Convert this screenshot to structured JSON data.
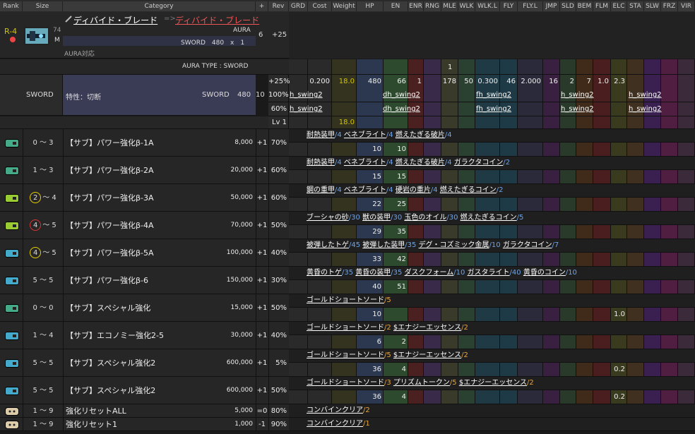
{
  "colors": {
    "HP": "#2b3850",
    "EN": "#2e4a2e",
    "ENR": "#4a2020",
    "RNG": "#3a2a4a",
    "MLE": "#3a3a2a",
    "WLK": "#2a4030",
    "WLKL": "#1f3a45",
    "FLY": "#1e3a46",
    "FLYL": "#2a2a3a",
    "JMP": "#3a2040",
    "SLD": "#2a3a2a",
    "BEM": "#402a1a",
    "FLM": "#4a1e1e",
    "ELC": "#3a3a1e",
    "STA": "#403020",
    "SLW": "#3a2050",
    "FRZ": "#501e40",
    "VIR": "#3a2a3a",
    "gold": "#d4c300",
    "accent": "#e44",
    "yellow_circle": "#e8d000",
    "red_circle": "#d33"
  },
  "header_labels": [
    "Rank",
    "Size",
    "Category",
    "+",
    "Rev",
    "GRD",
    "Cost",
    "Weight",
    "HP",
    "EN",
    "ENR",
    "RNG",
    "MLE",
    "WLK",
    "WLK.L",
    "FLY",
    "FLY.L",
    "JMP",
    "SLD",
    "BEM",
    "FLM",
    "ELC",
    "STA",
    "SLW",
    "FRZ",
    "VIR"
  ],
  "top": {
    "rank": "R-4",
    "size_num": "74",
    "size_letter": "M",
    "item_name": "ディバイド・ブレード",
    "arrow": "=>",
    "item_name_to": "ディバイド・ブレード",
    "aura": "AURA",
    "sword_line": "SWORD　480　x　1",
    "aura_support": "AURA対応",
    "plus": "6",
    "rev": "+25",
    "stat_mle": "1"
  },
  "aura_type": "AURA TYPE : SWORD",
  "sword_block": {
    "label": "SWORD",
    "trait": "特性：切断",
    "sword": "SWORD",
    "value": "480",
    "num": "10",
    "row1": {
      "rev": "+25%",
      "cost": "0.200",
      "weight": "18.0",
      "hp": "480",
      "en": "66",
      "enr": "1",
      "mle": "178",
      "wlk": "50",
      "wlkl": "0.300",
      "fly": "46",
      "flyl": "2.000",
      "jmp": "16",
      "sld": "2",
      "bem": "7",
      "flm": "1.0",
      "elc": "2.3"
    },
    "row2": {
      "rev": "100%",
      "s1": "h_swing2",
      "s2": "dh_swing2",
      "s3": "fh_swing2",
      "s4": "h_swing2",
      "s5": "h_swing2"
    },
    "row3": {
      "rev": "60%",
      "s1": "h_swing2",
      "s2": "dh_swing2",
      "s3": "fh_swing2",
      "s4": "h_swing2",
      "s5": "h_swing2"
    },
    "lv": "Lv 1",
    "lv_weight": "18.0"
  },
  "rows": [
    {
      "icon": "chip-icon",
      "rank": "0 ～ 3",
      "name": "【サブ】パワー強化β-1A",
      "cost": "8,000",
      "plus": "+1",
      "rev": "70%",
      "mats": [
        {
          "n": "耐熱装甲",
          "c": "/4"
        },
        {
          "n": "ベネブライト",
          "c": "/4"
        },
        {
          "n": "燃えたぎる破片",
          "c": "/4"
        }
      ],
      "hp": "10",
      "en": "10",
      "elc": ""
    },
    {
      "icon": "chip-icon",
      "rank": "1 ～ 3",
      "name": "【サブ】パワー強化β-2A",
      "cost": "20,000",
      "plus": "+1",
      "rev": "60%",
      "mats": [
        {
          "n": "耐熱装甲",
          "c": "/4"
        },
        {
          "n": "ベネブライト",
          "c": "/4"
        },
        {
          "n": "燃えたぎる破片",
          "c": "/4"
        },
        {
          "n": "ガラクタコイン",
          "c": "/2"
        }
      ],
      "hp": "15",
      "en": "15",
      "elc": ""
    },
    {
      "icon": "battery-icon",
      "rank_circle": "2",
      "rank_circle_color": "yellow",
      "rank": "～ 4",
      "name": "【サブ】パワー強化β-3A",
      "cost": "50,000",
      "plus": "+1",
      "rev": "60%",
      "mats": [
        {
          "n": "鋼の重甲",
          "c": "/4"
        },
        {
          "n": "ベネブライト",
          "c": "/4"
        },
        {
          "n": "硬岩の重片",
          "c": "/4"
        },
        {
          "n": "燃えたぎるコイン",
          "c": "/2"
        }
      ],
      "hp": "22",
      "en": "25",
      "elc": ""
    },
    {
      "icon": "battery-icon",
      "rank_circle": "4",
      "rank_circle_color": "red",
      "rank": "～ 5",
      "name": "【サブ】パワー強化β-4A",
      "cost": "70,000",
      "plus": "+1",
      "rev": "50%",
      "mats": [
        {
          "n": "ブーシャの砂",
          "c": "/30"
        },
        {
          "n": "獣の装甲",
          "c": "/30"
        },
        {
          "n": "玉色のオイル",
          "c": "/30"
        },
        {
          "n": "燃えたぎるコイン",
          "c": "/5"
        }
      ],
      "hp": "29",
      "en": "35",
      "elc": ""
    },
    {
      "icon": "arrow-chip-icon",
      "rank_circle": "4",
      "rank_circle_color": "yellow",
      "rank": "～ 5",
      "name": "【サブ】パワー強化β-5A",
      "cost": "100,000",
      "plus": "+1",
      "rev": "40%",
      "mats": [
        {
          "n": "被弾したトゲ",
          "c": "/45"
        },
        {
          "n": "被弾した装甲",
          "c": "/35"
        },
        {
          "n": "デグ・コズミック金属",
          "c": "/10"
        },
        {
          "n": "ガラクタコイン",
          "c": "/7"
        }
      ],
      "hp": "33",
      "en": "42",
      "elc": ""
    },
    {
      "icon": "arrow-chip-icon",
      "rank": "5 ～ 5",
      "name": "【サブ】パワー強化β-6",
      "cost": "150,000",
      "plus": "+1",
      "rev": "30%",
      "mats": [
        {
          "n": "黄昏のトゲ",
          "c": "/35"
        },
        {
          "n": "黄昏の装甲",
          "c": "/35"
        },
        {
          "n": "ダスクフォーム",
          "c": "/10"
        },
        {
          "n": "ガスタライト",
          "c": "/40"
        },
        {
          "n": "黄昏のコイン",
          "c": "/10"
        }
      ],
      "hp": "40",
      "en": "51",
      "elc": ""
    },
    {
      "icon": "chip-icon",
      "rank": "0 ～ 0",
      "name": "【サブ】スペシャル強化",
      "cost": "15,000",
      "plus": "+1",
      "rev": "50%",
      "mats": [
        {
          "n": "ゴールドショートソード",
          "c": "/5"
        }
      ],
      "hp": "10",
      "en": "",
      "elc": "1.0"
    },
    {
      "icon": "arrow-chip-icon",
      "rank": "1 ～ 4",
      "name": "【サブ】エコノミー強化2-5",
      "cost": "30,000",
      "plus": "+1",
      "rev": "40%",
      "mats": [
        {
          "n": "ゴールドショートソード",
          "c": "/2"
        },
        {
          "n": "$エナジーエッセンス",
          "c": "/2"
        }
      ],
      "hp": "6",
      "en": "2",
      "elc": ""
    },
    {
      "icon": "arrow-chip-icon",
      "rank": "5 ～ 5",
      "name": "【サブ】スペシャル強化2",
      "cost": "600,000",
      "plus": "+1",
      "rev": "5%",
      "mats": [
        {
          "n": "ゴールドショートソード",
          "c": "/5"
        },
        {
          "n": "$エナジーエッセンス",
          "c": "/2"
        }
      ],
      "hp": "36",
      "en": "4",
      "elc": "0.2"
    },
    {
      "icon": "arrow-chip-icon",
      "rank": "5 ～ 5",
      "name": "【サブ】スペシャル強化2",
      "cost": "600,000",
      "plus": "+1",
      "rev": "50%",
      "mats": [
        {
          "n": "ゴールドショートソード",
          "c": "/3"
        },
        {
          "n": "プリズムトークン",
          "c": "/5"
        },
        {
          "n": "$エナジーエッセンス",
          "c": "/2"
        }
      ],
      "hp": "36",
      "en": "4",
      "elc": "0.2"
    },
    {
      "icon": "face-icon",
      "rank": "1 ～ 9",
      "name": "強化リセットALL",
      "cost": "5,000",
      "plus": "=0",
      "rev": "80%",
      "mats": [
        {
          "n": "コンバインクリア",
          "c": "/2"
        }
      ],
      "hp": "",
      "en": "",
      "elc": ""
    },
    {
      "icon": "face-icon",
      "rank": "1 ～ 9",
      "name": "強化リセット1",
      "cost": "1,000",
      "plus": "-1",
      "rev": "90%",
      "mats": [
        {
          "n": "コンバインクリア",
          "c": "/1"
        }
      ],
      "hp": "",
      "en": "",
      "elc": ""
    }
  ]
}
